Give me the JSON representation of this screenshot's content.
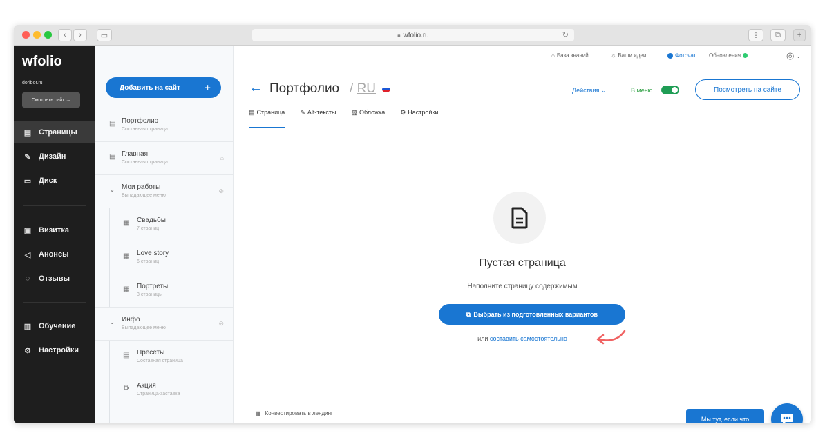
{
  "browser": {
    "url": "wfolio.ru",
    "colors": {
      "close": "#ff5f57",
      "minimize": "#febc2e",
      "maximize": "#28c840"
    }
  },
  "app": {
    "logo": "wfolio",
    "site_domain": "doribor.ru",
    "view_site_small": "Смотреть сайт →"
  },
  "leftnav": {
    "items": [
      {
        "label": "Страницы",
        "icon": "page-icon"
      },
      {
        "label": "Дизайн",
        "icon": "brush-icon"
      },
      {
        "label": "Диск",
        "icon": "disk-icon"
      },
      {
        "label": "Визитка",
        "icon": "card-icon"
      },
      {
        "label": "Анонсы",
        "icon": "megaphone-icon"
      },
      {
        "label": "Отзывы",
        "icon": "reviews-icon"
      },
      {
        "label": "Обучение",
        "icon": "book-icon"
      },
      {
        "label": "Настройки",
        "icon": "gear-icon"
      }
    ]
  },
  "pages": {
    "add_button": "Добавить на сайт",
    "items": [
      {
        "title": "Портфолио",
        "sub": "Составная страница"
      },
      {
        "title": "Главная",
        "sub": "Составная страница"
      },
      {
        "title": "Мои работы",
        "sub": "Выпадающее меню"
      },
      {
        "title": "Свадьбы",
        "sub": "7 страниц"
      },
      {
        "title": "Love story",
        "sub": "6 страниц"
      },
      {
        "title": "Портреты",
        "sub": "3 страницы"
      },
      {
        "title": "Инфо",
        "sub": "Выпадающее меню"
      },
      {
        "title": "Пресеты",
        "sub": "Составная страница"
      },
      {
        "title": "Акция",
        "sub": "Страница-заставка"
      }
    ]
  },
  "topbar": {
    "knowledge": "База знаний",
    "ideas": "Ваши идеи",
    "photochat": "Фоточат",
    "updates": "Обновления"
  },
  "header": {
    "title": "Портфолио",
    "lang": "RU",
    "actions": "Действия",
    "in_menu": "В меню",
    "view_site": "Посмотреть на сайте"
  },
  "tabs": [
    "Страница",
    "Alt-тексты",
    "Обложка",
    "Настройки"
  ],
  "empty": {
    "title": "Пустая страница",
    "subtitle": "Наполните страницу содержимым",
    "choose_button": "Выбрать из подготовленных вариантов",
    "or_text": "или",
    "compose_link": "составить самостоятельно"
  },
  "footer": {
    "convert": "Конвертировать в лендинг",
    "here_button": "Мы тут, если что"
  },
  "accent": "#1976d2"
}
